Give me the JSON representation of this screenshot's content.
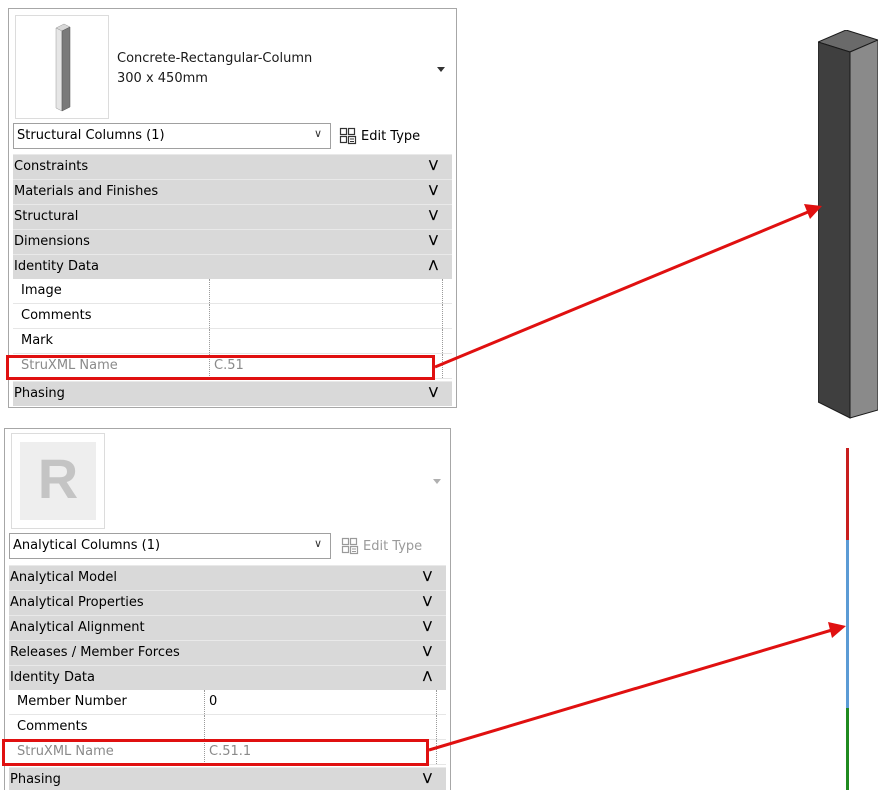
{
  "panel_top": {
    "type_name_line1": "Concrete-Rectangular-Column",
    "type_name_line2": "300 x 450mm",
    "selector_label": "Structural Columns (1)",
    "edit_type_label": "Edit Type",
    "sections_before": [
      "Constraints",
      "Materials and Finishes",
      "Structural",
      "Dimensions"
    ],
    "identity_section": "Identity Data",
    "rows": [
      {
        "name": "Image",
        "value": ""
      },
      {
        "name": "Comments",
        "value": ""
      },
      {
        "name": "Mark",
        "value": ""
      }
    ],
    "strux_row": {
      "name": "StruXML Name",
      "value": "C.51"
    },
    "last_section": "Phasing"
  },
  "panel_bottom": {
    "logo_letter": "R",
    "selector_label": "Analytical Columns (1)",
    "edit_type_label": "Edit Type",
    "sections_before": [
      "Analytical Model",
      "Analytical Properties",
      "Analytical Alignment",
      "Releases / Member Forces"
    ],
    "identity_section": "Identity Data",
    "rows": [
      {
        "name": "Member Number",
        "value": "0"
      },
      {
        "name": "Comments",
        "value": ""
      }
    ],
    "strux_row": {
      "name": "StruXML Name",
      "value": "C.51.1"
    },
    "last_section": "Phasing"
  },
  "colors": {
    "highlight": "#e01010",
    "section_bg": "#d9d9d9",
    "rod_top": "#c81e1e",
    "rod_mid": "#5b9bd5",
    "rod_bottom": "#1f8a1f"
  },
  "icons": {
    "expand": "double-chevron-down-icon",
    "collapse": "double-chevron-up-icon",
    "edit_type": "edit-type-icon",
    "dropdown": "chevron-down-icon"
  }
}
